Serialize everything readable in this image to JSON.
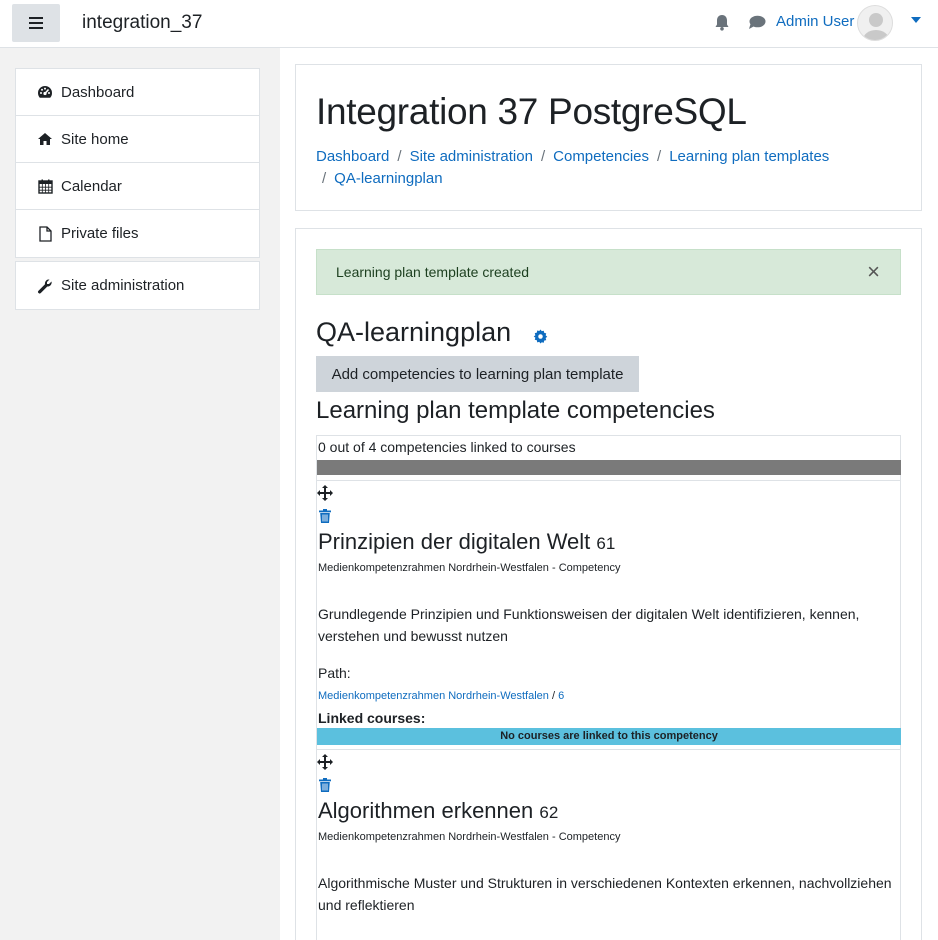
{
  "navbar": {
    "site_name": "integration_37",
    "user_name": "Admin User",
    "icons": [
      "menu-icon",
      "bell-icon",
      "chat-icon",
      "avatar-icon",
      "caret-down-icon"
    ]
  },
  "drawer": {
    "items": [
      {
        "label": "Dashboard",
        "icon": "tachometer-icon"
      },
      {
        "label": "Site home",
        "icon": "home-icon"
      },
      {
        "label": "Calendar",
        "icon": "calendar-icon"
      },
      {
        "label": "Private files",
        "icon": "file-icon"
      }
    ],
    "admin_item": {
      "label": "Site administration",
      "icon": "wrench-icon"
    }
  },
  "header": {
    "title": "Integration 37 PostgreSQL",
    "breadcrumb": [
      "Dashboard",
      "Site administration",
      "Competencies",
      "Learning plan templates",
      "QA-learningplan"
    ]
  },
  "alert": {
    "message": "Learning plan template created",
    "close": "×"
  },
  "plan": {
    "title": "QA-learningplan",
    "add_button": "Add competencies to learning plan template",
    "section_title": "Learning plan template competencies",
    "linked_summary": "0 out of 4 competencies linked to courses",
    "linked_fraction": 0.0
  },
  "competencies": [
    {
      "name": "Prinzipien der digitalen Welt",
      "id": "61",
      "framework": "Medienkompetenzrahmen Nordrhein-Westfalen - Competency",
      "description": "Grundlegende Prinzipien und Funktionsweisen der digitalen Welt identifizieren, kennen, verstehen und bewusst nutzen",
      "path_label": "Path:",
      "path_framework": "Medienkompetenzrahmen Nordrhein-Westfalen",
      "path_sep": "/",
      "path_number": "6",
      "linked_label": "Linked courses:",
      "no_courses": "No courses are linked to this competency"
    },
    {
      "name": "Algorithmen erkennen",
      "id": "62",
      "framework": "Medienkompetenzrahmen Nordrhein-Westfalen - Competency",
      "description": "Algorithmische Muster und Strukturen in verschiedenen Kontexten erkennen, nachvollziehen und reflektieren"
    }
  ],
  "colors": {
    "link": "#0f6cbf",
    "alert_bg": "#d7e9d9",
    "info_bar": "#5bc0de",
    "progress_bg": "#7a7a7a"
  }
}
